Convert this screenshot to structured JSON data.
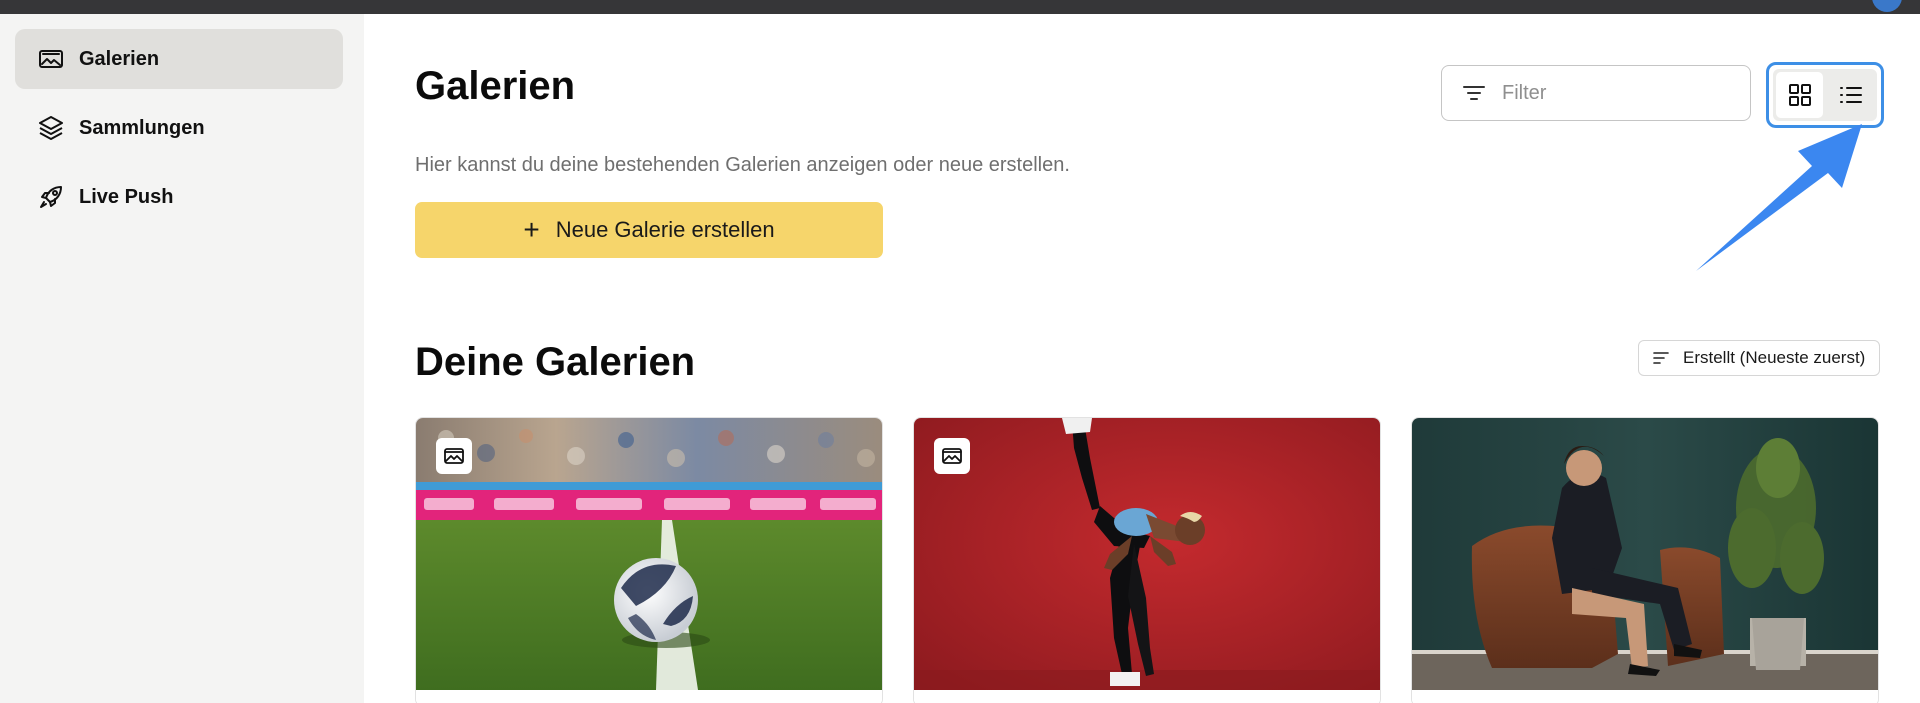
{
  "sidebar": {
    "items": [
      {
        "label": "Galerien",
        "icon": "gallery-icon",
        "active": true
      },
      {
        "label": "Sammlungen",
        "icon": "layers-icon",
        "active": false
      },
      {
        "label": "Live Push",
        "icon": "rocket-icon",
        "active": false
      }
    ]
  },
  "header": {
    "title": "Galerien",
    "subtitle": "Hier kannst du deine bestehenden Galerien anzeigen oder neue erstellen.",
    "new_button_label": "Neue Galerie erstellen"
  },
  "filter": {
    "placeholder": "Filter",
    "value": ""
  },
  "view_toggle": {
    "selected": "grid",
    "options": [
      "grid-view-icon",
      "list-view-icon"
    ]
  },
  "section": {
    "title": "Deine Galerien",
    "sort_label": "Erstellt (Neueste zuerst)"
  },
  "galleries": [
    {
      "subject": "football-stadium",
      "badge_icon": "gallery-icon"
    },
    {
      "subject": "athlete-high-kick",
      "badge_icon": "gallery-icon"
    },
    {
      "subject": "woman-armchair-phone",
      "badge_icon": "gallery-icon"
    }
  ],
  "colors": {
    "accent_yellow": "#f6d56b",
    "highlight_blue": "#3d8fe6",
    "sidebar_bg": "#f4f4f3",
    "sidebar_active_bg": "#e0dfdc"
  }
}
